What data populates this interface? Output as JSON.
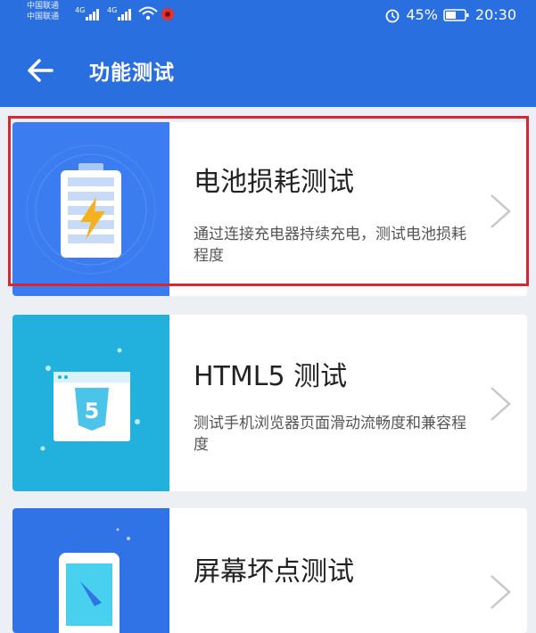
{
  "status_bar": {
    "carrier1": "中国联通",
    "carrier2": "中国联通",
    "network1": "4G",
    "network2": "4G",
    "battery_percent": "45%",
    "time": "20:30"
  },
  "header": {
    "title": "功能测试"
  },
  "items": [
    {
      "title": "电池损耗测试",
      "desc": "通过连接充电器持续充电，测试电池损耗程度",
      "thumb_color": "#3b7cf0",
      "icon": "battery-charging-icon"
    },
    {
      "title": "HTML5 测试",
      "desc": "测试手机浏览器页面滑动流畅度和兼容程度",
      "thumb_color": "#22b0dd",
      "icon": "html5-icon"
    },
    {
      "title": "屏幕坏点测试",
      "desc": "",
      "thumb_color": "#2f73e6",
      "icon": "phone-screen-icon"
    }
  ],
  "colors": {
    "app_bar": "#2a6fe0",
    "highlight": "#d7282f"
  }
}
